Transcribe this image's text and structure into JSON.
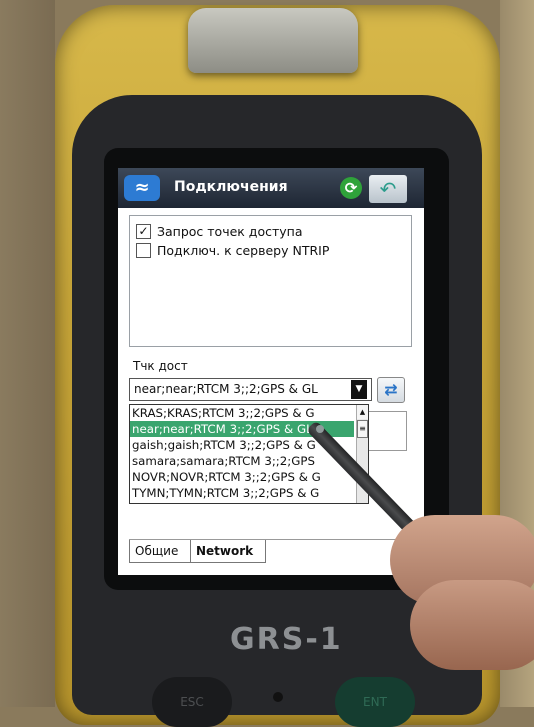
{
  "device": {
    "brand": "GRS-1",
    "keys": {
      "esc": "ESC",
      "ent": "ENT"
    }
  },
  "title_bar": {
    "title": "Подключения",
    "icons": {
      "logo": "app-logo-icon",
      "refresh": "refresh-icon",
      "back": "back-arrow-icon"
    }
  },
  "options": {
    "items": [
      {
        "label": "Запрос точек доступа",
        "checked": true,
        "mark": "✓"
      },
      {
        "label": "Подключ. к серверу NTRIP",
        "checked": false,
        "mark": ""
      }
    ]
  },
  "mountpoint": {
    "label": "Тчк дост",
    "selected_value": "near;near;RTCM 3;;2;GPS & GL",
    "options": [
      "KRAS;KRAS;RTCM 3;;2;GPS & G",
      "near;near;RTCM 3;;2;GPS & GL",
      "gaish;gaish;RTCM 3;;2;GPS & G",
      "samara;samara;RTCM 3;;2;GPS",
      "NOVR;NOVR;RTCM 3;;2;GPS & G",
      "TYMN;TYMN;RTCM 3;;2;GPS & G"
    ],
    "selected_index": 1,
    "colors": {
      "selection": "#3aa56e"
    }
  },
  "tabs": [
    {
      "label": "Общие"
    },
    {
      "label": "Network"
    }
  ]
}
